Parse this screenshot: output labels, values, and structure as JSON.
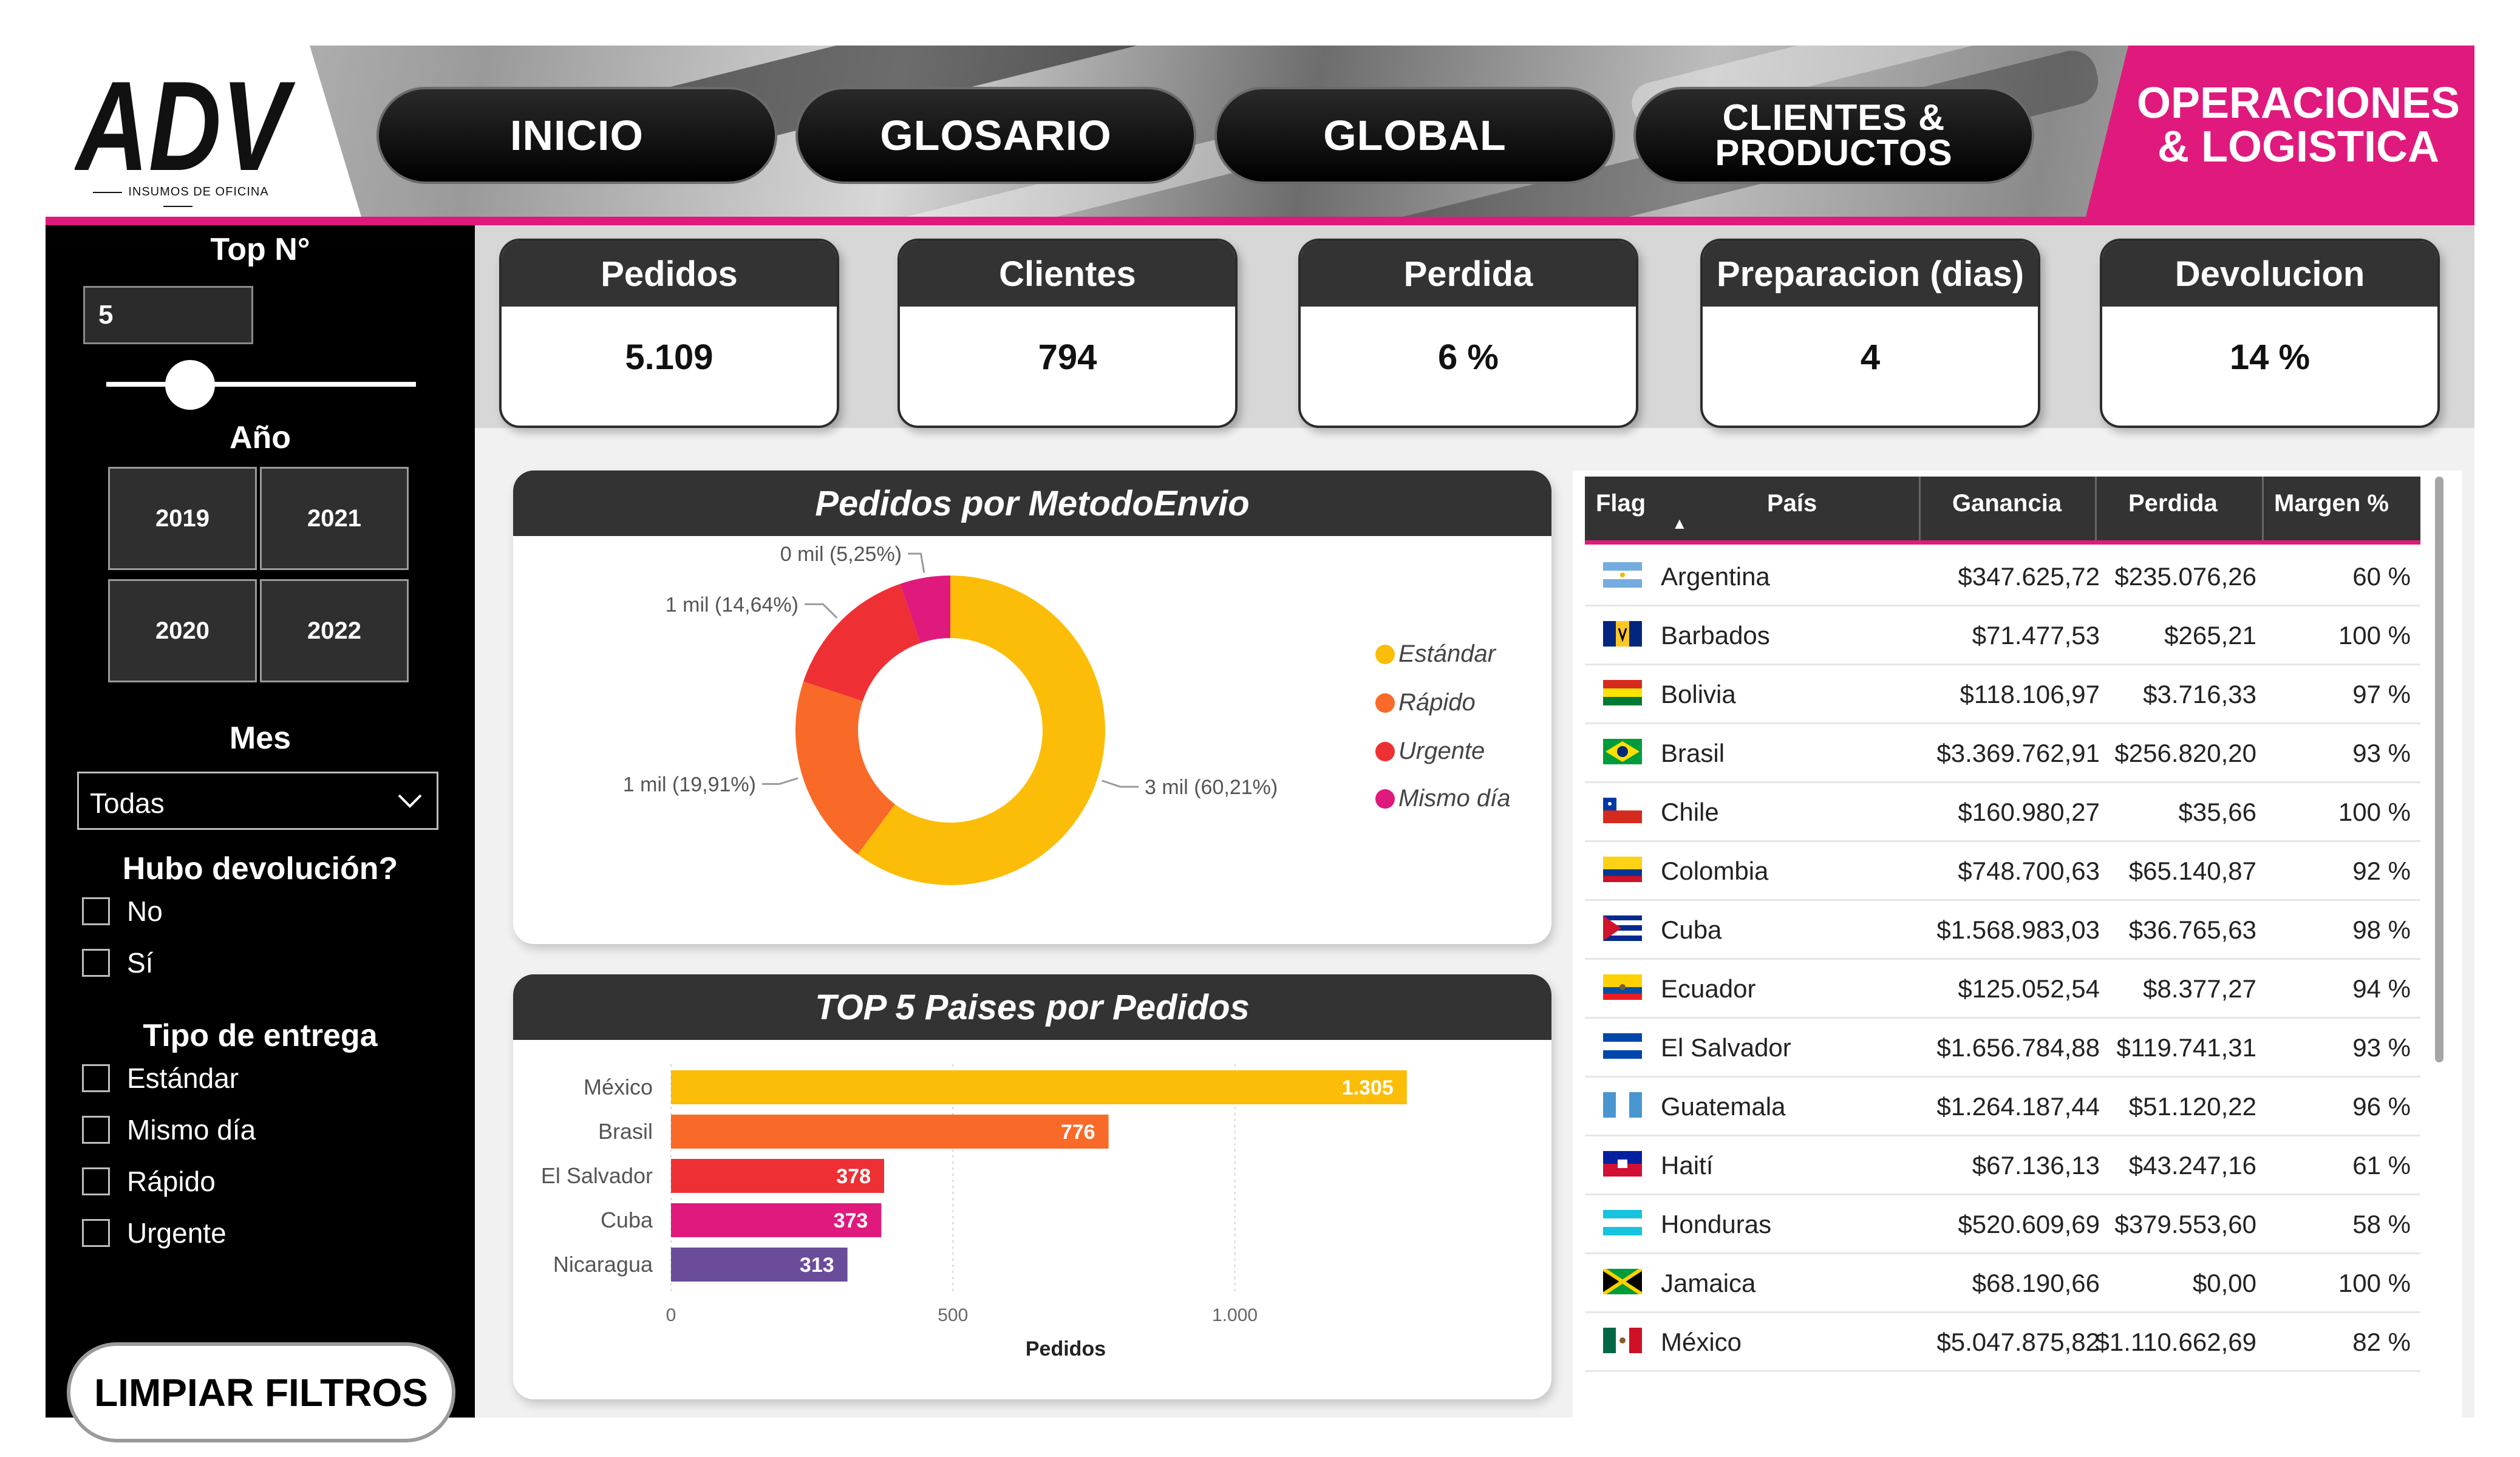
{
  "brand": {
    "logo_text": "ADV",
    "tagline": "INSUMOS DE OFICINA"
  },
  "nav": {
    "inicio": "INICIO",
    "glosario": "GLOSARIO",
    "global": "GLOBAL",
    "clientes_line1": "CLIENTES &",
    "clientes_line2": "PRODUCTOS",
    "ops_line1": "OPERACIONES",
    "ops_line2": "& LOGISTICA"
  },
  "filters": {
    "top_title": "Top N°",
    "top_value": "5",
    "top_slider_fraction": 0.25,
    "year_title": "Año",
    "years": [
      "2019",
      "2021",
      "2020",
      "2022"
    ],
    "month_title": "Mes",
    "month_value": "Todas",
    "return_title": "Hubo devolución?",
    "return_options": [
      "No",
      "Sí"
    ],
    "delivery_title": "Tipo de entrega",
    "delivery_options": [
      "Estándar",
      "Mismo día",
      "Rápido",
      "Urgente"
    ],
    "clear_button": "LIMPIAR FILTROS"
  },
  "kpis": [
    {
      "label": "Pedidos",
      "value": "5.109"
    },
    {
      "label": "Clientes",
      "value": "794"
    },
    {
      "label": "Perdida",
      "value": "6 %"
    },
    {
      "label": "Preparacion (dias)",
      "value": "4"
    },
    {
      "label": "Devolucion",
      "value": "14 %"
    }
  ],
  "chart_data": [
    {
      "type": "pie",
      "title": "Pedidos por MetodoEnvio",
      "categories": [
        "Estándar",
        "Rápido",
        "Urgente",
        "Mismo día"
      ],
      "values": [
        60.21,
        19.91,
        14.64,
        5.25
      ],
      "data_labels": [
        "3 mil (60,21%)",
        "1 mil (19,91%)",
        "1 mil (14,64%)",
        "0 mil (5,25%)"
      ],
      "colors": [
        "#fbbd08",
        "#f96a28",
        "#ee3034",
        "#e0197d"
      ],
      "legend": "right",
      "donut": true
    },
    {
      "type": "bar",
      "orientation": "horizontal",
      "title": "TOP 5 Paises por Pedidos",
      "categories": [
        "México",
        "Brasil",
        "El Salvador",
        "Cuba",
        "Nicaragua"
      ],
      "values": [
        1305,
        776,
        378,
        373,
        313
      ],
      "value_labels": [
        "1.305",
        "776",
        "378",
        "373",
        "313"
      ],
      "colors": [
        "#fbbd08",
        "#f96a28",
        "#ee3034",
        "#e0197d",
        "#6b4c9a"
      ],
      "xlabel": "Pedidos",
      "xticks": [
        "0",
        "500",
        "1.000"
      ],
      "xlim": [
        0,
        1400
      ],
      "grid": "vertical"
    }
  ],
  "table": {
    "columns": [
      "Flag",
      "País",
      "Ganancia",
      "Perdida",
      "Margen %"
    ],
    "sort_indicator": "▲",
    "rows": [
      {
        "flag": "argentina",
        "pais": "Argentina",
        "ganancia": "$347.625,72",
        "perdida": "$235.076,26",
        "margen": "60 %"
      },
      {
        "flag": "barbados",
        "pais": "Barbados",
        "ganancia": "$71.477,53",
        "perdida": "$265,21",
        "margen": "100 %"
      },
      {
        "flag": "bolivia",
        "pais": "Bolivia",
        "ganancia": "$118.106,97",
        "perdida": "$3.716,33",
        "margen": "97 %"
      },
      {
        "flag": "brasil",
        "pais": "Brasil",
        "ganancia": "$3.369.762,91",
        "perdida": "$256.820,20",
        "margen": "93 %"
      },
      {
        "flag": "chile",
        "pais": "Chile",
        "ganancia": "$160.980,27",
        "perdida": "$35,66",
        "margen": "100 %"
      },
      {
        "flag": "colombia",
        "pais": "Colombia",
        "ganancia": "$748.700,63",
        "perdida": "$65.140,87",
        "margen": "92 %"
      },
      {
        "flag": "cuba",
        "pais": "Cuba",
        "ganancia": "$1.568.983,03",
        "perdida": "$36.765,63",
        "margen": "98 %"
      },
      {
        "flag": "ecuador",
        "pais": "Ecuador",
        "ganancia": "$125.052,54",
        "perdida": "$8.377,27",
        "margen": "94 %"
      },
      {
        "flag": "elsalvador",
        "pais": "El Salvador",
        "ganancia": "$1.656.784,88",
        "perdida": "$119.741,31",
        "margen": "93 %"
      },
      {
        "flag": "guatemala",
        "pais": "Guatemala",
        "ganancia": "$1.264.187,44",
        "perdida": "$51.120,22",
        "margen": "96 %"
      },
      {
        "flag": "haiti",
        "pais": "Haití",
        "ganancia": "$67.136,13",
        "perdida": "$43.247,16",
        "margen": "61 %"
      },
      {
        "flag": "honduras",
        "pais": "Honduras",
        "ganancia": "$520.609,69",
        "perdida": "$379.553,60",
        "margen": "58 %"
      },
      {
        "flag": "jamaica",
        "pais": "Jamaica",
        "ganancia": "$68.190,66",
        "perdida": "$0,00",
        "margen": "100 %"
      },
      {
        "flag": "mexico",
        "pais": "México",
        "ganancia": "$5.047.875,82",
        "perdida": "$1.110.662,69",
        "margen": "82 %"
      }
    ]
  },
  "colors": {
    "accent": "#e0197d",
    "panel_dark": "#333333",
    "sidebar": "#000000"
  }
}
